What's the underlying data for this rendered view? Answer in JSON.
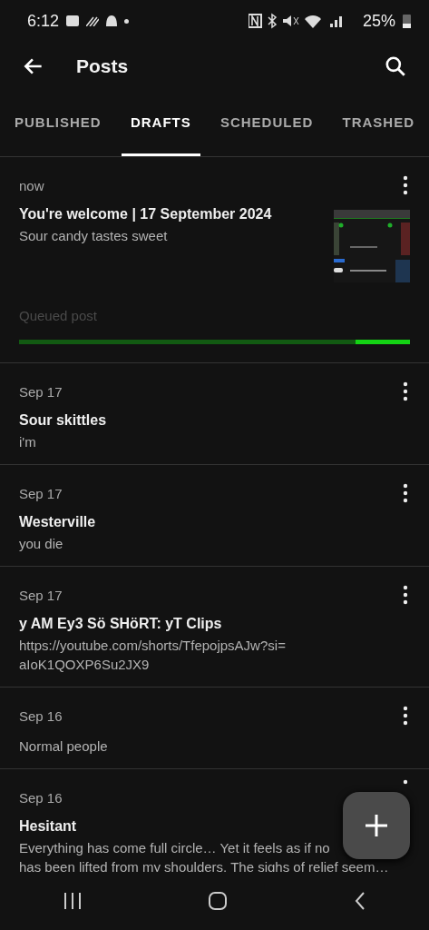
{
  "status_bar": {
    "time": "6:12",
    "battery": "25%"
  },
  "toolbar": {
    "title": "Posts"
  },
  "tabs": [
    {
      "label": "PUBLISHED",
      "selected": false
    },
    {
      "label": "DRAFTS",
      "selected": true
    },
    {
      "label": "SCHEDULED",
      "selected": false
    },
    {
      "label": "TRASHED",
      "selected": false
    }
  ],
  "posts": [
    {
      "date": "now",
      "title": "You're welcome | 17 September 2024",
      "body": [
        "Sour candy tastes sweet"
      ],
      "thumbnail": {
        "kind": "picture"
      },
      "queue": {
        "label": "Queued post",
        "level": 0.86
      }
    },
    {
      "date": "Sep 17",
      "title": "Sour skittles",
      "body": [
        "i'm"
      ]
    },
    {
      "date": "Sep 17",
      "title": "Westerville",
      "body": [
        "you die"
      ]
    },
    {
      "date": "Sep 17",
      "title": "y AM Ey3 Sö SHöRT: yT Clips",
      "body": [
        "https://youtube.com/shorts/TfepojpsAJw?si=",
        "aIoK1QOXP6Su2JX9"
      ]
    },
    {
      "date": "Sep 16",
      "body": [
        "Normal people"
      ]
    },
    {
      "date": "Sep 16",
      "title": "Hesitant",
      "body": [
        "Everything has come full circle… Yet it feels as if no",
        "has been lifted from my shoulders. The sighs of relief seem…"
      ]
    }
  ]
}
